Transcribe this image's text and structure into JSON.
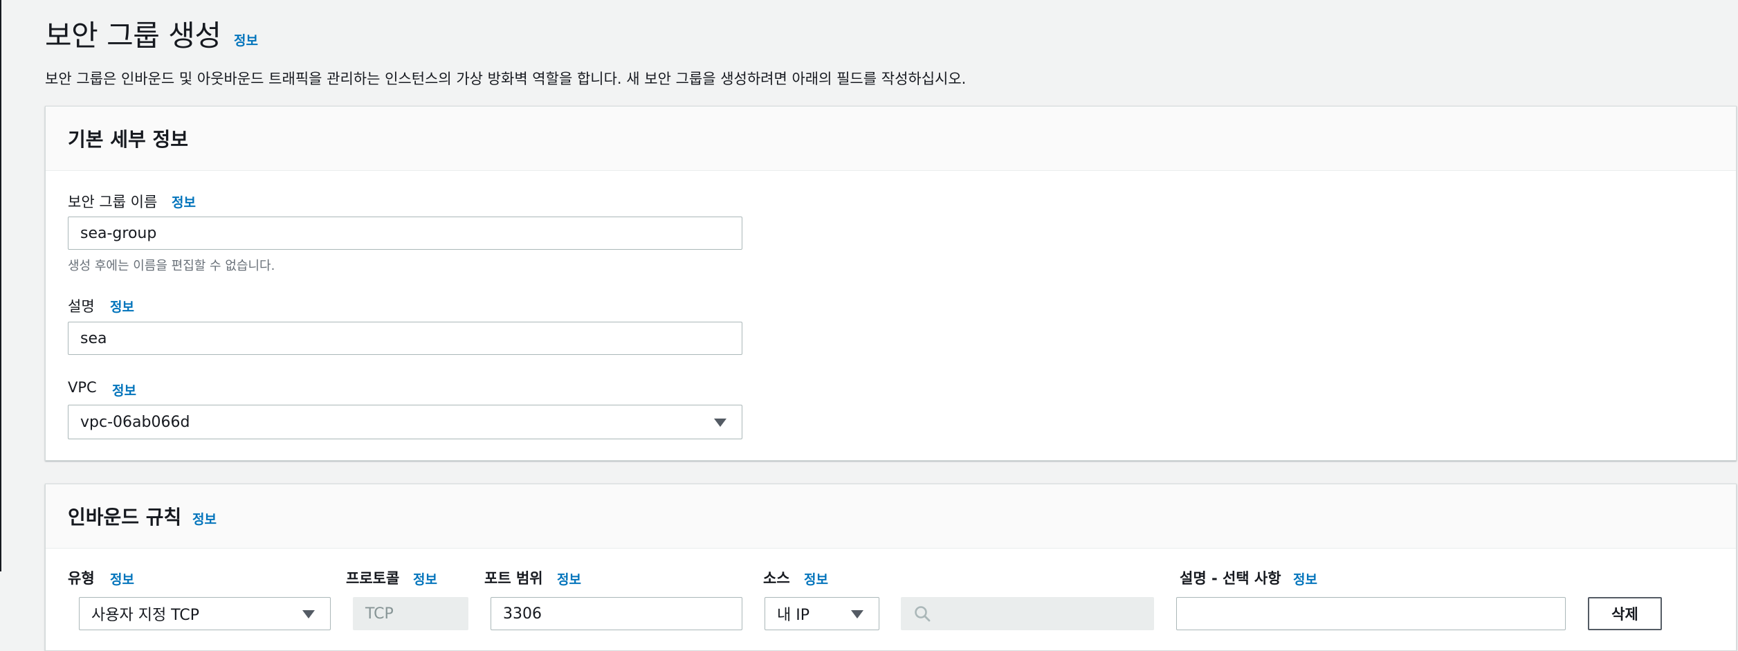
{
  "page": {
    "title": "보안 그룹 생성",
    "info": "정보",
    "description": "보안 그룹은 인바운드 및 아웃바운드 트래픽을 관리하는 인스턴스의 가상 방화벽 역할을 합니다. 새 보안 그룹을 생성하려면 아래의 필드를 작성하십시오."
  },
  "basic_details": {
    "title": "기본 세부 정보",
    "name": {
      "label": "보안 그룹 이름",
      "info": "정보",
      "value": "sea-group",
      "hint": "생성 후에는 이름을 편집할 수 없습니다."
    },
    "description": {
      "label": "설명",
      "info": "정보",
      "value": "sea"
    },
    "vpc": {
      "label": "VPC",
      "info": "정보",
      "value": "vpc-06ab066d"
    }
  },
  "inbound_rules": {
    "title": "인바운드 규칙",
    "info": "정보",
    "columns": {
      "type": {
        "label": "유형",
        "info": "정보"
      },
      "protocol": {
        "label": "프로토콜",
        "info": "정보"
      },
      "port_range": {
        "label": "포트 범위",
        "info": "정보"
      },
      "source": {
        "label": "소스",
        "info": "정보"
      },
      "description": {
        "label": "설명 - 선택 사항",
        "info": "정보"
      }
    },
    "rows": [
      {
        "type": "사용자 지정 TCP",
        "protocol": "TCP",
        "port_range": "3306",
        "source": "내 IP",
        "source_search": "",
        "description": "",
        "delete_label": "삭제"
      }
    ]
  },
  "icons": {
    "dropdown": "caret-down-icon",
    "search": "search-icon"
  },
  "colors": {
    "link": "#0073bb",
    "background": "#f2f3f3",
    "disabled": "#eaeded"
  }
}
